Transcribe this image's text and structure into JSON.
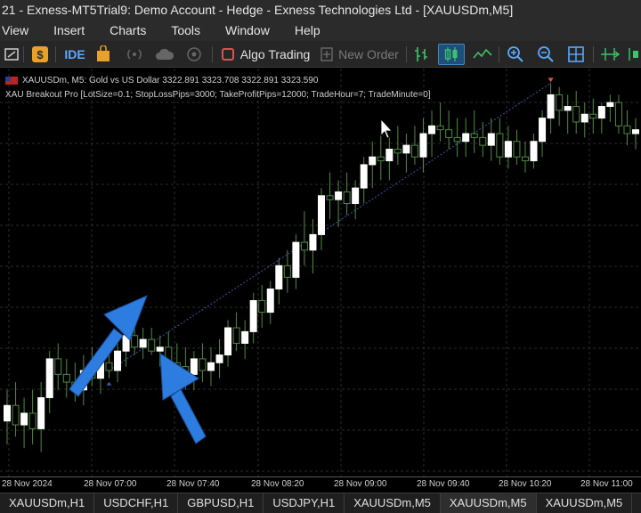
{
  "window": {
    "title": "21 - Exness-MT5Trial9: Demo Account - Hedge - Exness Technologies Ltd - [XAUUSDm,M5]"
  },
  "menu": [
    "View",
    "Insert",
    "Charts",
    "Tools",
    "Window",
    "Help"
  ],
  "toolbar": {
    "ide_label": "IDE",
    "algo_trading_label": "Algo Trading",
    "new_order_label": "New Order"
  },
  "chart": {
    "symbol_line": "XAUUSDm, M5:  Gold vs US Dollar  3322.891 3323.708 3322.891 3323.590",
    "ea_line": "XAU Breakout Pro [LotSize=0.1; StopLossPips=3000; TakeProfitPips=12000; TradeHour=7; TradeMinute=0]",
    "colors": {
      "bull_body": "#ffffff",
      "bear_body": "#000000",
      "wick": "#4e8a3e",
      "grid": "#2a2a2a",
      "trade_line": "#3a56a8",
      "arrow": "#2d7ce0"
    }
  },
  "chart_data": {
    "type": "candlestick",
    "note_symbol": "XAUUSDm M5",
    "candles": [
      {
        "o": 0.12,
        "h": 0.2,
        "l": 0.06,
        "c": 0.16
      },
      {
        "o": 0.16,
        "h": 0.22,
        "l": 0.08,
        "c": 0.11
      },
      {
        "o": 0.11,
        "h": 0.18,
        "l": 0.05,
        "c": 0.14
      },
      {
        "o": 0.14,
        "h": 0.2,
        "l": 0.06,
        "c": 0.1
      },
      {
        "o": 0.1,
        "h": 0.22,
        "l": 0.04,
        "c": 0.18
      },
      {
        "o": 0.18,
        "h": 0.3,
        "l": 0.14,
        "c": 0.28
      },
      {
        "o": 0.28,
        "h": 0.32,
        "l": 0.2,
        "c": 0.24
      },
      {
        "o": 0.24,
        "h": 0.28,
        "l": 0.18,
        "c": 0.22
      },
      {
        "o": 0.22,
        "h": 0.27,
        "l": 0.17,
        "c": 0.2
      },
      {
        "o": 0.2,
        "h": 0.29,
        "l": 0.16,
        "c": 0.25
      },
      {
        "o": 0.25,
        "h": 0.31,
        "l": 0.21,
        "c": 0.23
      },
      {
        "o": 0.23,
        "h": 0.3,
        "l": 0.19,
        "c": 0.27
      },
      {
        "o": 0.27,
        "h": 0.33,
        "l": 0.23,
        "c": 0.25
      },
      {
        "o": 0.25,
        "h": 0.34,
        "l": 0.22,
        "c": 0.3
      },
      {
        "o": 0.3,
        "h": 0.36,
        "l": 0.26,
        "c": 0.34
      },
      {
        "o": 0.34,
        "h": 0.37,
        "l": 0.29,
        "c": 0.31
      },
      {
        "o": 0.31,
        "h": 0.36,
        "l": 0.28,
        "c": 0.33
      },
      {
        "o": 0.33,
        "h": 0.36,
        "l": 0.29,
        "c": 0.3
      },
      {
        "o": 0.3,
        "h": 0.34,
        "l": 0.26,
        "c": 0.31
      },
      {
        "o": 0.31,
        "h": 0.35,
        "l": 0.24,
        "c": 0.27
      },
      {
        "o": 0.27,
        "h": 0.32,
        "l": 0.2,
        "c": 0.26
      },
      {
        "o": 0.26,
        "h": 0.31,
        "l": 0.2,
        "c": 0.24
      },
      {
        "o": 0.24,
        "h": 0.3,
        "l": 0.2,
        "c": 0.28
      },
      {
        "o": 0.28,
        "h": 0.32,
        "l": 0.22,
        "c": 0.25
      },
      {
        "o": 0.25,
        "h": 0.31,
        "l": 0.21,
        "c": 0.27
      },
      {
        "o": 0.27,
        "h": 0.33,
        "l": 0.23,
        "c": 0.29
      },
      {
        "o": 0.29,
        "h": 0.38,
        "l": 0.26,
        "c": 0.36
      },
      {
        "o": 0.36,
        "h": 0.4,
        "l": 0.3,
        "c": 0.32
      },
      {
        "o": 0.32,
        "h": 0.38,
        "l": 0.28,
        "c": 0.35
      },
      {
        "o": 0.35,
        "h": 0.45,
        "l": 0.32,
        "c": 0.43
      },
      {
        "o": 0.43,
        "h": 0.47,
        "l": 0.36,
        "c": 0.4
      },
      {
        "o": 0.4,
        "h": 0.48,
        "l": 0.37,
        "c": 0.46
      },
      {
        "o": 0.46,
        "h": 0.54,
        "l": 0.42,
        "c": 0.52
      },
      {
        "o": 0.52,
        "h": 0.56,
        "l": 0.45,
        "c": 0.49
      },
      {
        "o": 0.49,
        "h": 0.6,
        "l": 0.46,
        "c": 0.58
      },
      {
        "o": 0.58,
        "h": 0.66,
        "l": 0.52,
        "c": 0.56
      },
      {
        "o": 0.56,
        "h": 0.64,
        "l": 0.5,
        "c": 0.6
      },
      {
        "o": 0.6,
        "h": 0.72,
        "l": 0.56,
        "c": 0.7
      },
      {
        "o": 0.7,
        "h": 0.76,
        "l": 0.64,
        "c": 0.69
      },
      {
        "o": 0.69,
        "h": 0.74,
        "l": 0.62,
        "c": 0.71
      },
      {
        "o": 0.71,
        "h": 0.76,
        "l": 0.65,
        "c": 0.68
      },
      {
        "o": 0.68,
        "h": 0.74,
        "l": 0.64,
        "c": 0.72
      },
      {
        "o": 0.72,
        "h": 0.8,
        "l": 0.68,
        "c": 0.78
      },
      {
        "o": 0.78,
        "h": 0.84,
        "l": 0.72,
        "c": 0.8
      },
      {
        "o": 0.8,
        "h": 0.86,
        "l": 0.74,
        "c": 0.79
      },
      {
        "o": 0.79,
        "h": 0.85,
        "l": 0.74,
        "c": 0.82
      },
      {
        "o": 0.82,
        "h": 0.88,
        "l": 0.78,
        "c": 0.81
      },
      {
        "o": 0.81,
        "h": 0.86,
        "l": 0.76,
        "c": 0.83
      },
      {
        "o": 0.83,
        "h": 0.88,
        "l": 0.78,
        "c": 0.8
      },
      {
        "o": 0.8,
        "h": 0.9,
        "l": 0.76,
        "c": 0.86
      },
      {
        "o": 0.86,
        "h": 0.92,
        "l": 0.8,
        "c": 0.88
      },
      {
        "o": 0.88,
        "h": 0.94,
        "l": 0.84,
        "c": 0.87
      },
      {
        "o": 0.87,
        "h": 0.92,
        "l": 0.82,
        "c": 0.85
      },
      {
        "o": 0.85,
        "h": 0.9,
        "l": 0.8,
        "c": 0.84
      },
      {
        "o": 0.84,
        "h": 0.9,
        "l": 0.8,
        "c": 0.86
      },
      {
        "o": 0.86,
        "h": 0.92,
        "l": 0.81,
        "c": 0.85
      },
      {
        "o": 0.85,
        "h": 0.89,
        "l": 0.8,
        "c": 0.83
      },
      {
        "o": 0.83,
        "h": 0.9,
        "l": 0.79,
        "c": 0.86
      },
      {
        "o": 0.86,
        "h": 0.9,
        "l": 0.78,
        "c": 0.8
      },
      {
        "o": 0.8,
        "h": 0.88,
        "l": 0.77,
        "c": 0.84
      },
      {
        "o": 0.84,
        "h": 0.87,
        "l": 0.78,
        "c": 0.8
      },
      {
        "o": 0.8,
        "h": 0.84,
        "l": 0.76,
        "c": 0.79
      },
      {
        "o": 0.79,
        "h": 0.86,
        "l": 0.77,
        "c": 0.84
      },
      {
        "o": 0.84,
        "h": 0.92,
        "l": 0.8,
        "c": 0.9
      },
      {
        "o": 0.9,
        "h": 0.99,
        "l": 0.86,
        "c": 0.96
      },
      {
        "o": 0.96,
        "h": 0.98,
        "l": 0.88,
        "c": 0.92
      },
      {
        "o": 0.92,
        "h": 0.96,
        "l": 0.86,
        "c": 0.93
      },
      {
        "o": 0.93,
        "h": 0.97,
        "l": 0.86,
        "c": 0.89
      },
      {
        "o": 0.89,
        "h": 0.94,
        "l": 0.85,
        "c": 0.91
      },
      {
        "o": 0.91,
        "h": 0.95,
        "l": 0.86,
        "c": 0.9
      },
      {
        "o": 0.9,
        "h": 0.94,
        "l": 0.86,
        "c": 0.93
      },
      {
        "o": 0.93,
        "h": 0.96,
        "l": 0.89,
        "c": 0.94
      },
      {
        "o": 0.94,
        "h": 0.96,
        "l": 0.86,
        "c": 0.88
      },
      {
        "o": 0.88,
        "h": 0.92,
        "l": 0.83,
        "c": 0.86
      },
      {
        "o": 0.86,
        "h": 0.9,
        "l": 0.82,
        "c": 0.87
      }
    ],
    "time_labels": [
      "28 Nov 2024",
      "28 Nov 07:00",
      "28 Nov 07:40",
      "28 Nov 08:20",
      "28 Nov 09:00",
      "28 Nov 09:40",
      "28 Nov 10:20",
      "28 Nov 11:00"
    ],
    "grid": true
  },
  "tabs": [
    "XAUUSDm,H1",
    "USDCHF,H1",
    "GBPUSD,H1",
    "USDJPY,H1",
    "XAUUSDm,M5",
    "XAUUSDm,M5",
    "XAUUSDm,M5"
  ]
}
